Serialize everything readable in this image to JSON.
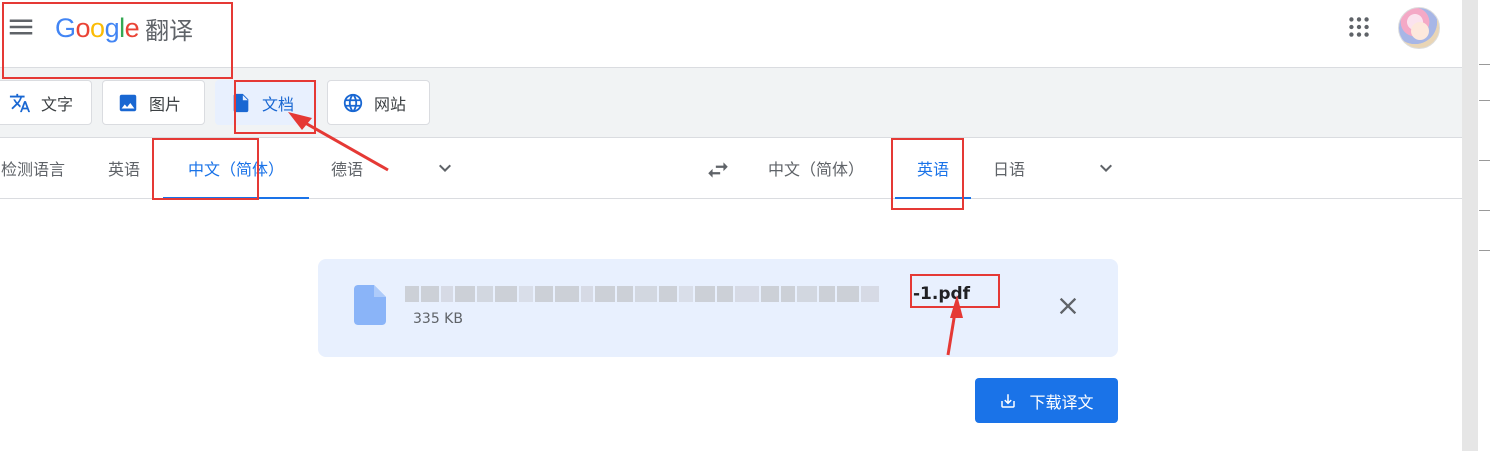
{
  "header": {
    "logo_letters": [
      {
        "char": "G",
        "color": "#4285F4"
      },
      {
        "char": "o",
        "color": "#EA4335"
      },
      {
        "char": "o",
        "color": "#FBBC05"
      },
      {
        "char": "g",
        "color": "#4285F4"
      },
      {
        "char": "l",
        "color": "#34A853"
      },
      {
        "char": "e",
        "color": "#EA4335"
      }
    ],
    "product_name": "翻译",
    "menu_icon": "hamburger-menu-icon",
    "apps_icon": "apps-grid-icon",
    "avatar_icon": "user-avatar"
  },
  "modes": [
    {
      "label": "文字",
      "icon": "translate-icon",
      "active": false
    },
    {
      "label": "图片",
      "icon": "image-icon",
      "active": false
    },
    {
      "label": "文档",
      "icon": "document-icon",
      "active": true
    },
    {
      "label": "网站",
      "icon": "globe-icon",
      "active": false
    }
  ],
  "source_languages": [
    {
      "label": "检测语言",
      "active": false
    },
    {
      "label": "英语",
      "active": false
    },
    {
      "label": "中文（简体）",
      "active": true
    },
    {
      "label": "德语",
      "active": false
    }
  ],
  "target_languages": [
    {
      "label": "中文（简体）",
      "active": false
    },
    {
      "label": "英语",
      "active": true
    },
    {
      "label": "日语",
      "active": false
    }
  ],
  "file": {
    "name_visible_suffix": "-1.pdf",
    "size": "335 KB",
    "icon": "file-icon",
    "close_icon": "close-icon"
  },
  "download": {
    "label": "下载译文",
    "icon": "download-icon"
  },
  "colors": {
    "accent": "#1a73e8",
    "active_bg": "#e8f0fe",
    "annotation": "#e53935"
  }
}
